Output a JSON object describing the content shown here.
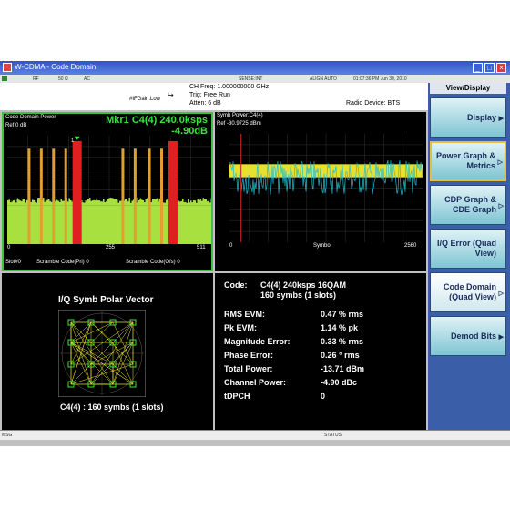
{
  "window": {
    "title": "W-CDMA - Code Domain",
    "min_symbol": "_",
    "max_symbol": "□",
    "close_symbol": "×"
  },
  "status_strip": {
    "items": [
      "RF",
      "50 Ω",
      "AC",
      "SENSE:INT",
      "ALIGN AUTO"
    ],
    "datetime": "01:07:36 PM Jun 30, 2010"
  },
  "info": {
    "ch_freq": "CH Freq: 1.000000000 GHz",
    "trig": "Trig: Free Run",
    "atten": "Atten: 6 dB",
    "if_gain": "#IFGain:Low",
    "radio_device": "Radio Device: BTS"
  },
  "cdp_panel": {
    "title": "Code Domain Power",
    "ref": "Ref  0 dB",
    "marker_line1": "Mkr1 C4(4) 240.0ksps",
    "marker_line2": "-4.90dB",
    "marker_label": "1",
    "x_min": "0",
    "x_mid": "255",
    "x_max": "511",
    "footer_slot": "Slot#0",
    "footer_pri": "Scramble Code(Pri) 0",
    "footer_ofs": "Scramble Code(Ofs) 0",
    "colors": {
      "active": "#e0a030",
      "marker": "#e02020",
      "noise": "#a8e040",
      "border": "#40c040"
    }
  },
  "symb_panel": {
    "title": "Symb Power:C4(4)",
    "ref": "Ref  -30.9725 dBm",
    "x_min": "0",
    "x_label": "Symbol",
    "x_max": "2560",
    "colors": {
      "trace": "#20c0d0",
      "band": "#e8e030"
    }
  },
  "polar_panel": {
    "title": "I/Q Symb Polar Vector",
    "caption": "C4(4) : 160 symbs (1 slots)"
  },
  "metrics": {
    "code_label": "Code:",
    "code_value": "C4(4) 240ksps 16QAM",
    "code_sub": "160 symbs (1 slots)",
    "rows": [
      {
        "label": "RMS EVM:",
        "value": "0.47 % rms"
      },
      {
        "label": "Pk EVM:",
        "value": "1.14 % pk"
      },
      {
        "label": "Magnitude Error:",
        "value": "0.33 % rms"
      },
      {
        "label": "Phase Error:",
        "value": "0.26 ° rms"
      },
      {
        "label": "Total Power:",
        "value": "-13.71 dBm"
      },
      {
        "label": "Channel Power:",
        "value": "-4.90 dBc"
      },
      {
        "label": "tDPCH",
        "value": "0"
      }
    ]
  },
  "softkeys": {
    "header": "View/Display",
    "items": [
      {
        "label": "Display"
      },
      {
        "label": "Power Graph & Metrics"
      },
      {
        "label": "CDP Graph & CDE Graph"
      },
      {
        "label": "I/Q Error (Quad View)"
      },
      {
        "label": "Code Domain (Quad View)"
      },
      {
        "label": "Demod Bits"
      }
    ]
  },
  "bottom": {
    "msg": "MSG",
    "status": "STATUS"
  }
}
